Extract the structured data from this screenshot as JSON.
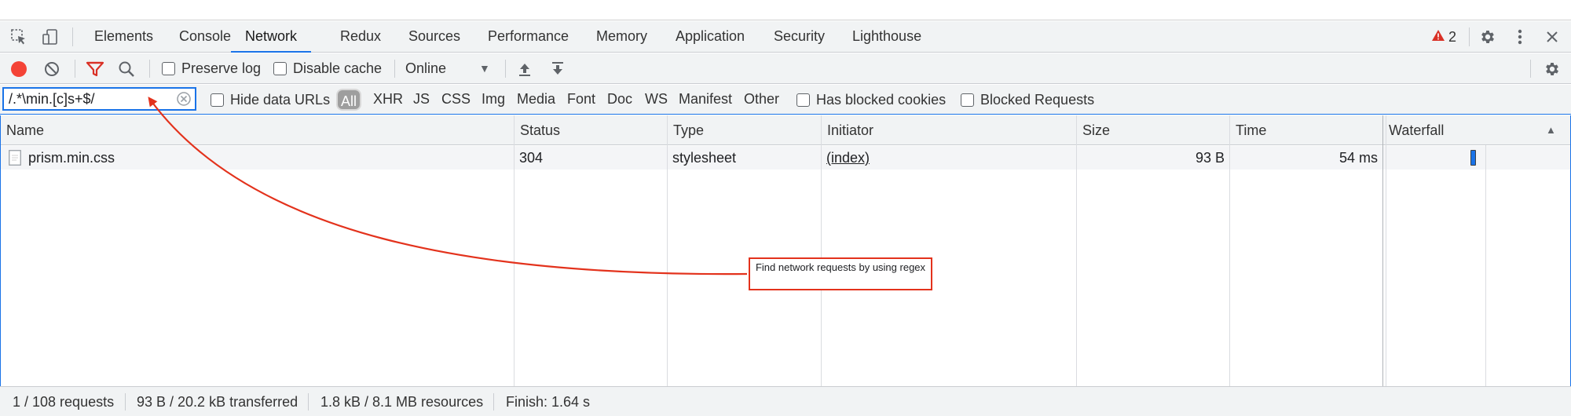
{
  "tabs": [
    {
      "label": "Elements"
    },
    {
      "label": "Console"
    },
    {
      "label": "Network",
      "active": true
    },
    {
      "label": "Redux"
    },
    {
      "label": "Sources"
    },
    {
      "label": "Performance"
    },
    {
      "label": "Memory"
    },
    {
      "label": "Application"
    },
    {
      "label": "Security"
    },
    {
      "label": "Lighthouse"
    }
  ],
  "issues": {
    "count": "2",
    "icon": "warning-triangle-icon",
    "color": "#d93025"
  },
  "toolbar": {
    "record_icon": "record-icon",
    "record_color": "#f44336",
    "clear_icon": "clear-icon",
    "filter_icon": "filter-icon",
    "filter_color": "#d93025",
    "search_icon": "search-icon",
    "preserve_log_label": "Preserve log",
    "disable_cache_label": "Disable cache",
    "throttle_value": "Online",
    "import_icon": "upload-icon",
    "export_icon": "download-icon",
    "settings_icon": "gear-icon"
  },
  "filter": {
    "value": "/.*\\min.[c]s+$/",
    "hide_data_urls_label": "Hide data URLs",
    "types": [
      "All",
      "XHR",
      "JS",
      "CSS",
      "Img",
      "Media",
      "Font",
      "Doc",
      "WS",
      "Manifest",
      "Other"
    ],
    "active_type": "All",
    "blocked_cookies_label": "Has blocked cookies",
    "blocked_requests_label": "Blocked Requests"
  },
  "table": {
    "columns": [
      "Name",
      "Status",
      "Type",
      "Initiator",
      "Size",
      "Time",
      "Waterfall"
    ],
    "rows": [
      {
        "name": "prism.min.css",
        "status": "304",
        "type": "stylesheet",
        "initiator": "(index)",
        "size": "93 B",
        "time": "54 ms"
      }
    ]
  },
  "status": {
    "requests": "1 / 108 requests",
    "transferred": "93 B / 20.2 kB transferred",
    "resources": "1.8 kB / 8.1 MB resources",
    "finish": "Finish: 1.64 s"
  },
  "annotation": {
    "text": "Find network requests by using regex",
    "color": "#e3321c"
  }
}
